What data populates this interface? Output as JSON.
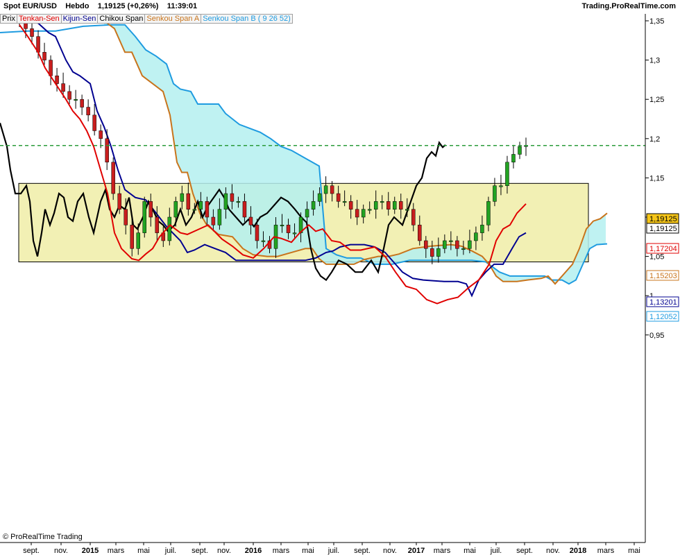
{
  "header": {
    "symbol": "Spot EUR/USD",
    "period": "Hebdo",
    "quote": "1,19125 (+0,26%)",
    "time": "11:39:01",
    "site": "Trading.ProRealTime.com"
  },
  "legend": [
    {
      "label": "Prix",
      "color": "#000000"
    },
    {
      "label": "Tenkan-Sen",
      "color": "#e00000"
    },
    {
      "label": "Kijun-Sen",
      "color": "#000090"
    },
    {
      "label": "Chikou Span",
      "color": "#000000"
    },
    {
      "label": "Senkou Span A",
      "color": "#c8741c"
    },
    {
      "label": "Senkou Span B ( 9 26 52)",
      "color": "#1e9be0"
    }
  ],
  "credit": "© ProRealTime Trading",
  "colors": {
    "up": "#22a322",
    "down": "#c81e1e",
    "tenkan": "#e00000",
    "kijun": "#000090",
    "chikou": "#000000",
    "spanA": "#c8741c",
    "spanB": "#1e9be0",
    "cloud": "#b4f0f0",
    "box_fill": "#f2f0b4",
    "price_line": "#2a9b3a"
  },
  "chart_data": {
    "type": "line",
    "title": "Spot EUR/USD Hebdo",
    "x_tick_labels": [
      "sept.",
      "nov.",
      "2015",
      "mars",
      "mai",
      "juil.",
      "sept.",
      "nov.",
      "2016",
      "mars",
      "mai",
      "juil.",
      "sept.",
      "nov.",
      "2017",
      "mars",
      "mai",
      "juil.",
      "sept.",
      "nov.",
      "2018",
      "mars",
      "mai"
    ],
    "x_tick_bold": [
      false,
      false,
      true,
      false,
      false,
      false,
      false,
      false,
      true,
      false,
      false,
      false,
      false,
      false,
      true,
      false,
      false,
      false,
      false,
      false,
      true,
      false,
      false
    ],
    "y_tick_labels": [
      "1,35",
      "1,3",
      "1,25",
      "1,2",
      "1,15",
      "1,1",
      "1,05",
      "1",
      "0,95"
    ],
    "y_ticks": [
      1.35,
      1.3,
      1.25,
      1.2,
      1.15,
      1.1,
      1.05,
      1.0,
      0.95
    ],
    "ylim": [
      0.95,
      1.355
    ],
    "x_range": [
      "2014-08",
      "2018-05"
    ],
    "grid": false,
    "current_price": 1.19125,
    "value_badges": [
      {
        "value": 1.19125,
        "text": "1,19125",
        "series": "Prix",
        "color": "#f5c518"
      },
      {
        "value": 1.19125,
        "text": "1,19125",
        "series": "Prix",
        "color": "#ffffff"
      },
      {
        "value": 1.17204,
        "text": "1,17204",
        "series": "Tenkan-Sen",
        "color": "#e00000"
      },
      {
        "value": 1.15203,
        "text": "1,15203",
        "series": "Senkou Span A",
        "color": "#c8741c"
      },
      {
        "value": 1.13201,
        "text": "1,13201",
        "series": "Kijun-Sen",
        "color": "#000090"
      },
      {
        "value": 1.12052,
        "text": "1,12052",
        "series": "Senkou Span B",
        "color": "#1e9be0"
      }
    ],
    "range_box": {
      "high": 1.143,
      "low": 1.043,
      "from": "2014-10",
      "to": "2018-02"
    },
    "series": [
      {
        "name": "Prix",
        "kind": "candlestick",
        "approx_closes_week": [
          1.348,
          1.34,
          1.33,
          1.31,
          1.3,
          1.28,
          1.27,
          1.26,
          1.25,
          1.25,
          1.24,
          1.23,
          1.21,
          1.2,
          1.17,
          1.13,
          1.11,
          1.09,
          1.06,
          1.08,
          1.12,
          1.1,
          1.08,
          1.07,
          1.1,
          1.12,
          1.13,
          1.11,
          1.11,
          1.12,
          1.1,
          1.09,
          1.11,
          1.13,
          1.12,
          1.12,
          1.1,
          1.09,
          1.07,
          1.07,
          1.06,
          1.09,
          1.09,
          1.08,
          1.08,
          1.1,
          1.11,
          1.12,
          1.13,
          1.14,
          1.13,
          1.12,
          1.12,
          1.11,
          1.1,
          1.11,
          1.11,
          1.12,
          1.12,
          1.11,
          1.12,
          1.11,
          1.11,
          1.09,
          1.07,
          1.06,
          1.05,
          1.06,
          1.07,
          1.07,
          1.06,
          1.06,
          1.07,
          1.08,
          1.09,
          1.12,
          1.14,
          1.14,
          1.17,
          1.18,
          1.19,
          1.19125
        ]
      },
      {
        "name": "Tenkan-Sen"
      },
      {
        "name": "Kijun-Sen"
      },
      {
        "name": "Chikou Span"
      },
      {
        "name": "Senkou Span A"
      },
      {
        "name": "Senkou Span B"
      }
    ]
  }
}
